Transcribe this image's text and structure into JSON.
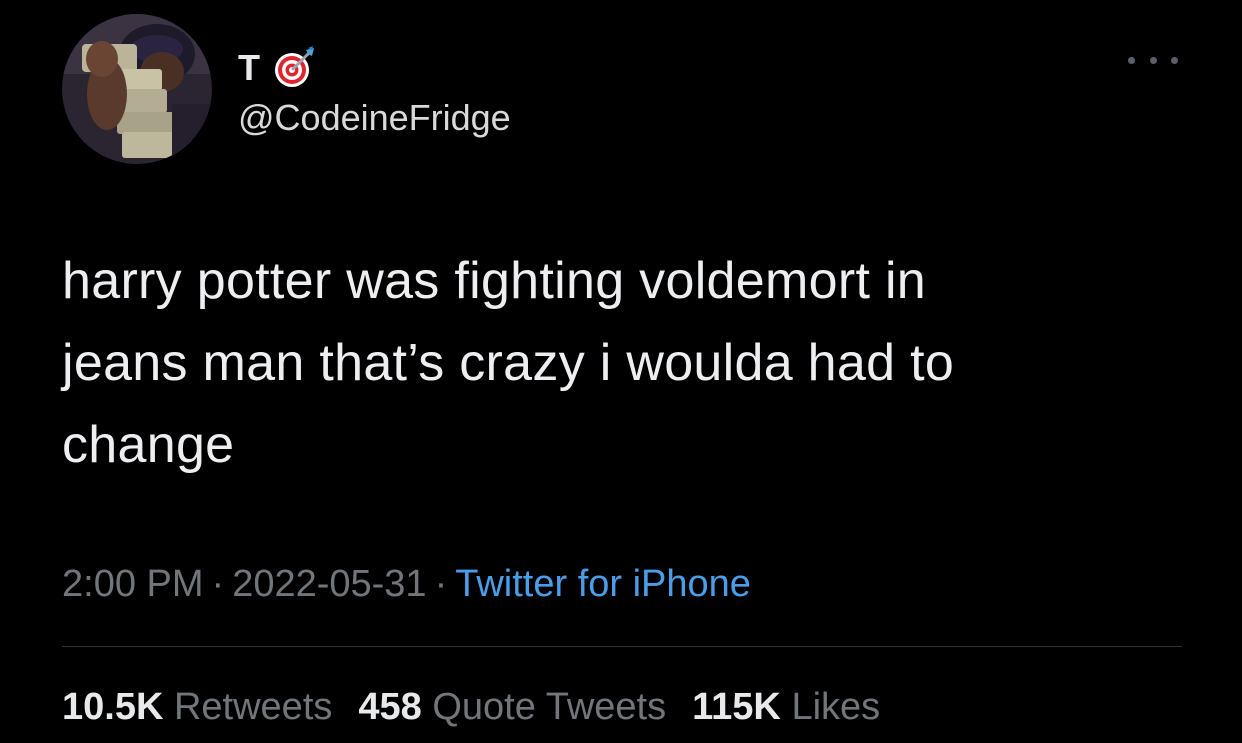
{
  "author": {
    "display_name": "T",
    "emoji_icon": "direct-hit-target-emoji",
    "handle": "@CodeineFridge"
  },
  "tweet": {
    "text_lines": [
      "harry potter was fighting voldemort in",
      "jeans man that’s crazy i woulda had to",
      "change"
    ]
  },
  "meta": {
    "time": "2:00 PM",
    "separator": "·",
    "date": "2022-05-31",
    "source": "Twitter for iPhone"
  },
  "stats": {
    "retweets_count": "10.5K",
    "retweets_label": "Retweets",
    "quotes_count": "458",
    "quotes_label": "Quote Tweets",
    "likes_count": "115K",
    "likes_label": "Likes"
  },
  "colors": {
    "background": "#000000",
    "text": "#e7e9ea",
    "secondary": "#71767b",
    "link": "#4a9ee9",
    "divider": "#2f3336"
  }
}
